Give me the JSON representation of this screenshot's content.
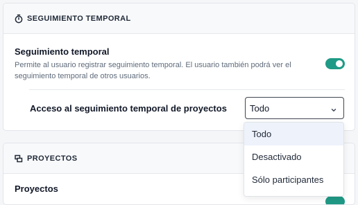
{
  "time_tracking_panel": {
    "header": "SEGUIMIENTO TEMPORAL",
    "header_icon": "stopwatch-icon",
    "setting_title": "Seguimiento temporal",
    "setting_description": "Permite al usuario registrar seguimiento temporal. El usuario también podrá ver el seguimiento temporal de otros usuarios.",
    "toggle_enabled": true,
    "access_label": "Acceso al seguimiento temporal de proyectos",
    "access_select": {
      "value": "Todo",
      "options": [
        "Todo",
        "Desactivado",
        "Sólo participantes"
      ],
      "highlighted": "Todo"
    }
  },
  "projects_panel": {
    "header": "PROYECTOS",
    "header_icon": "projects-icon",
    "setting_title": "Proyectos"
  },
  "colors": {
    "accent": "#1f9a86",
    "highlight": "#eef2fb"
  }
}
